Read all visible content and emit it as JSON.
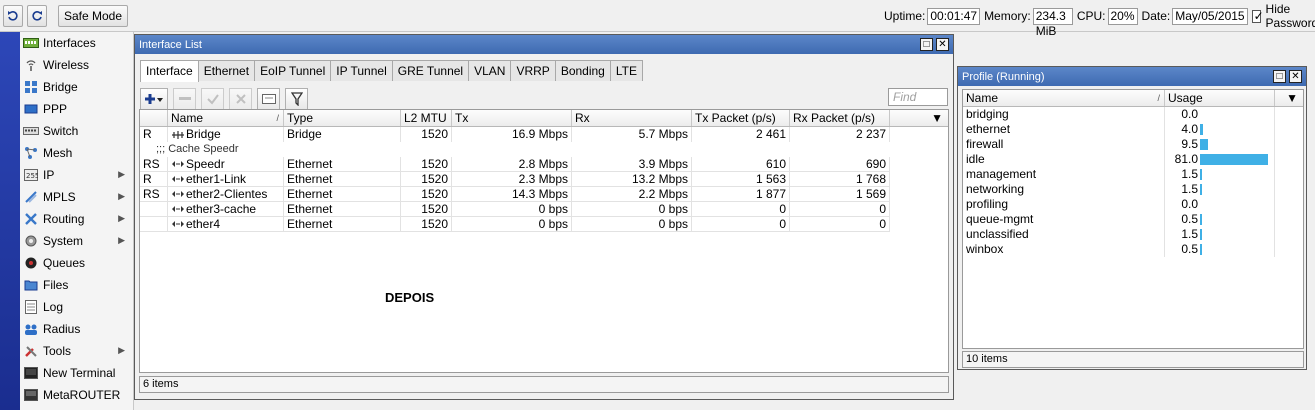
{
  "toolbar": {
    "undo_icon": "undo-icon",
    "redo_icon": "redo-icon",
    "safe_mode": "Safe Mode",
    "uptime_label": "Uptime:",
    "uptime": "00:01:47",
    "memory_label": "Memory:",
    "memory": "234.3 MiB",
    "cpu_label": "CPU:",
    "cpu": "20%",
    "date_label": "Date:",
    "date": "May/05/2015",
    "hide_passwords": "Hide Passwords"
  },
  "sidebar": {
    "items": [
      {
        "label": "Interfaces",
        "icon": "interfaces-icon"
      },
      {
        "label": "Wireless",
        "icon": "wireless-icon"
      },
      {
        "label": "Bridge",
        "icon": "bridge-icon"
      },
      {
        "label": "PPP",
        "icon": "ppp-icon"
      },
      {
        "label": "Switch",
        "icon": "switch-icon"
      },
      {
        "label": "Mesh",
        "icon": "mesh-icon"
      },
      {
        "label": "IP",
        "icon": "ip-icon"
      },
      {
        "label": "MPLS",
        "icon": "mpls-icon"
      },
      {
        "label": "Routing",
        "icon": "routing-icon"
      },
      {
        "label": "System",
        "icon": "system-icon"
      },
      {
        "label": "Queues",
        "icon": "queues-icon"
      },
      {
        "label": "Files",
        "icon": "files-icon"
      },
      {
        "label": "Log",
        "icon": "log-icon"
      },
      {
        "label": "Radius",
        "icon": "radius-icon"
      },
      {
        "label": "Tools",
        "icon": "tools-icon"
      },
      {
        "label": "New Terminal",
        "icon": "terminal-icon"
      },
      {
        "label": "MetaROUTER",
        "icon": "metarouter-icon"
      }
    ]
  },
  "interface_window": {
    "title": "Interface List",
    "tabs": [
      "Interface",
      "Ethernet",
      "EoIP Tunnel",
      "IP Tunnel",
      "GRE Tunnel",
      "VLAN",
      "VRRP",
      "Bonding",
      "LTE"
    ],
    "find_placeholder": "Find",
    "columns": [
      "",
      "Name",
      "Type",
      "L2 MTU",
      "Tx",
      "Rx",
      "Tx Packet (p/s)",
      "Rx Packet (p/s)"
    ],
    "rows": [
      {
        "flags": "R",
        "name": "Bridge",
        "type": "Bridge",
        "mtu": "1520",
        "tx": "16.9 Mbps",
        "rx": "5.7 Mbps",
        "txp": "2 461",
        "rxp": "2 237"
      },
      {
        "comment": ";;; Cache Speedr"
      },
      {
        "flags": "RS",
        "name": "Speedr",
        "type": "Ethernet",
        "mtu": "1520",
        "tx": "2.8 Mbps",
        "rx": "3.9 Mbps",
        "txp": "610",
        "rxp": "690"
      },
      {
        "flags": "R",
        "name": "ether1-Link",
        "type": "Ethernet",
        "mtu": "1520",
        "tx": "2.3 Mbps",
        "rx": "13.2 Mbps",
        "txp": "1 563",
        "rxp": "1 768"
      },
      {
        "flags": "RS",
        "name": "ether2-Clientes",
        "type": "Ethernet",
        "mtu": "1520",
        "tx": "14.3 Mbps",
        "rx": "2.2 Mbps",
        "txp": "1 877",
        "rxp": "1 569"
      },
      {
        "flags": "",
        "name": "ether3-cache",
        "type": "Ethernet",
        "mtu": "1520",
        "tx": "0 bps",
        "rx": "0 bps",
        "txp": "0",
        "rxp": "0"
      },
      {
        "flags": "",
        "name": "ether4",
        "type": "Ethernet",
        "mtu": "1520",
        "tx": "0 bps",
        "rx": "0 bps",
        "txp": "0",
        "rxp": "0"
      }
    ],
    "status": "6 items"
  },
  "annotation": "DEPOIS",
  "profile_window": {
    "title": "Profile (Running)",
    "columns": [
      "Name",
      "Usage"
    ],
    "rows": [
      {
        "name": "bridging",
        "usage": "0.0",
        "value": 0.0
      },
      {
        "name": "ethernet",
        "usage": "4.0",
        "value": 4.0
      },
      {
        "name": "firewall",
        "usage": "9.5",
        "value": 9.5
      },
      {
        "name": "idle",
        "usage": "81.0",
        "value": 81.0
      },
      {
        "name": "management",
        "usage": "1.5",
        "value": 1.5
      },
      {
        "name": "networking",
        "usage": "1.5",
        "value": 1.5
      },
      {
        "name": "profiling",
        "usage": "0.0",
        "value": 0.0
      },
      {
        "name": "queue-mgmt",
        "usage": "0.5",
        "value": 0.5
      },
      {
        "name": "unclassified",
        "usage": "1.5",
        "value": 1.5
      },
      {
        "name": "winbox",
        "usage": "0.5",
        "value": 0.5
      }
    ],
    "status": "10 items",
    "bar_color": "#3fb0e6"
  }
}
